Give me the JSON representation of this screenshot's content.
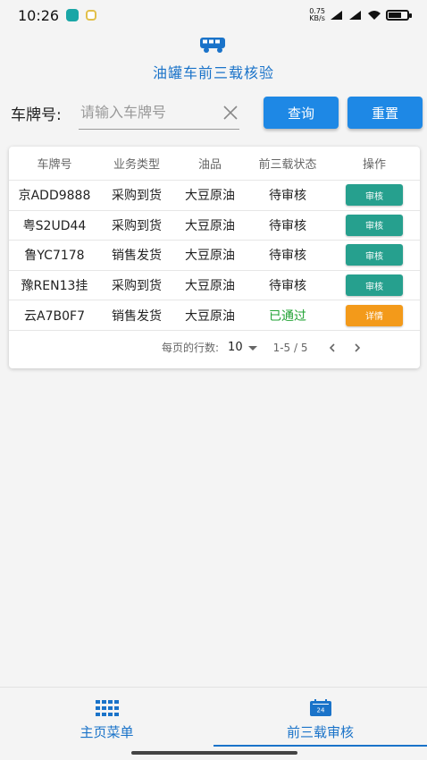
{
  "status_bar": {
    "time": "10:26",
    "net_speed_value": "0.75",
    "net_speed_unit": "KB/s",
    "app_icon_colors": [
      "#1aa6a6",
      "#e2c04a"
    ]
  },
  "header": {
    "icon": "van-icon",
    "title": "油罐车前三载核验",
    "accent_color": "#1a73c9"
  },
  "search": {
    "label": "车牌号:",
    "placeholder": "请输入车牌号",
    "value": "",
    "query_button": "查询",
    "reset_button": "重置"
  },
  "table": {
    "headers": [
      "车牌号",
      "业务类型",
      "油品",
      "前三载状态",
      "操作"
    ],
    "rows": [
      {
        "plate": "京ADD9888",
        "business": "采购到货",
        "oil": "大豆原油",
        "status": "待审核",
        "action": "审核",
        "action_kind": "review"
      },
      {
        "plate": "粤S2UD44",
        "business": "采购到货",
        "oil": "大豆原油",
        "status": "待审核",
        "action": "审核",
        "action_kind": "review"
      },
      {
        "plate": "鲁YC7178",
        "business": "销售发货",
        "oil": "大豆原油",
        "status": "待审核",
        "action": "审核",
        "action_kind": "review"
      },
      {
        "plate": "豫REN13挂",
        "business": "采购到货",
        "oil": "大豆原油",
        "status": "待审核",
        "action": "审核",
        "action_kind": "review"
      },
      {
        "plate": "云A7B0F7",
        "business": "销售发货",
        "oil": "大豆原油",
        "status": "已通过",
        "action": "详情",
        "action_kind": "detail"
      }
    ],
    "pagination": {
      "rows_per_page_label": "每页的行数:",
      "rows_per_page": "10",
      "range": "1-5 / 5"
    }
  },
  "colors": {
    "primary": "#1e88e5",
    "review_button": "#26a08e",
    "detail_button": "#f39a1a",
    "status_passed": "#22a335"
  },
  "bottom_nav": {
    "items": [
      {
        "label": "主页菜单",
        "icon": "grid-menu-icon"
      },
      {
        "label": "前三载审核",
        "icon": "calendar-24-icon",
        "active": true
      }
    ]
  }
}
